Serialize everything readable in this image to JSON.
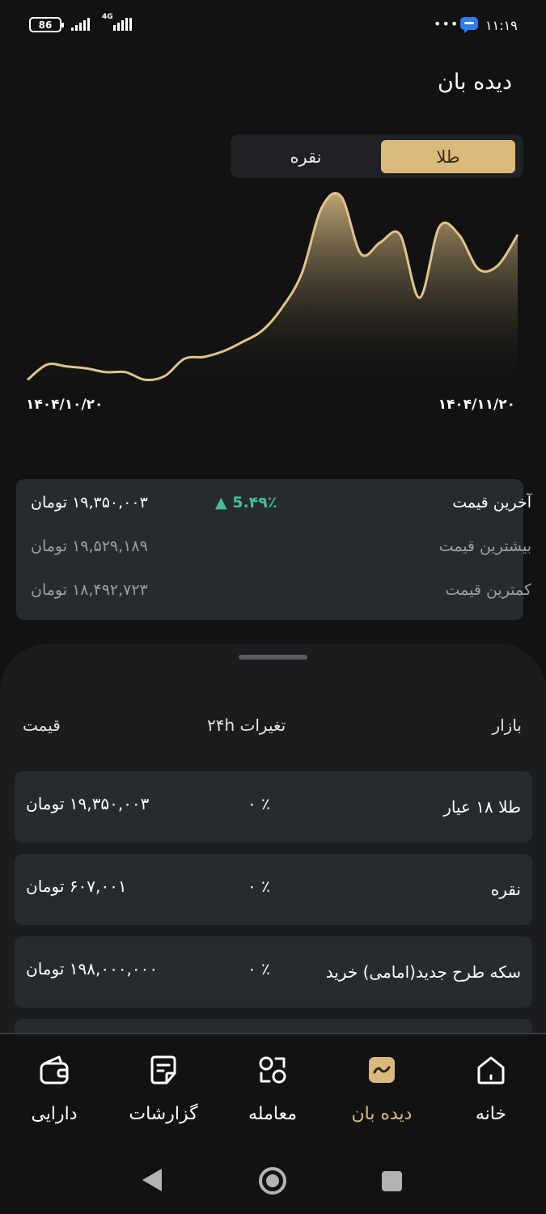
{
  "status_bar": {
    "battery": "86",
    "network": "4G",
    "dots": "•••",
    "time": "۱۱:۱۹"
  },
  "header": {
    "title": "دیده بان"
  },
  "toggle": {
    "gold_label": "طلا",
    "silver_label": "نقره",
    "selected": "طلا"
  },
  "chart": {
    "start_date": "۱۴۰۴/۱۰/۲۰",
    "end_date": "۱۴۰۴/۱۱/۲۰",
    "line_color": "#e0c48a"
  },
  "chart_data": {
    "type": "area",
    "title": "",
    "xlabel": "",
    "ylabel": "",
    "x_range": [
      "۱۴۰۴/۱۰/۲۰",
      "۱۴۰۴/۱۱/۲۰"
    ],
    "values": [
      0.02,
      0.1,
      0.09,
      0.08,
      0.06,
      0.06,
      0.02,
      0.04,
      0.13,
      0.14,
      0.17,
      0.22,
      0.28,
      0.4,
      0.58,
      0.92,
      0.98,
      0.68,
      0.74,
      0.78,
      0.45,
      0.82,
      0.78,
      0.6,
      0.62,
      0.78
    ],
    "grid": false,
    "legend": "none"
  },
  "price_card": {
    "last_price_label": "آخرین قیمت",
    "last_price_value": "۱۹,۳۵۰,۰۰۳ تومان",
    "change": "▲ 5.۴۹٪",
    "max_price_label": "بیشترین قیمت",
    "max_price_value": "۱۹,۵۲۹,۱۸۹ تومان",
    "min_price_label": "کمترین قیمت",
    "min_price_value": "۱۸,۴۹۲,۷۲۳ تومان"
  },
  "market": {
    "headers": {
      "market": "بازار",
      "change": "تغیرات ۲۴h",
      "price": "قیمت"
    },
    "rows": [
      {
        "name": "طلا ۱۸ عیار",
        "change": "٪ ۰",
        "price": "۱۹,۳۵۰,۰۰۳ تومان"
      },
      {
        "name": "نقره",
        "change": "٪ ۰",
        "price": "۶۰۷,۰۰۱ تومان"
      },
      {
        "name": "سکه طرح جدید(امامی) خرید",
        "change": "٪ ۰",
        "price": "۱۹۸,۰۰۰,۰۰۰ تومان"
      }
    ]
  },
  "bottom_nav": {
    "home": "خانه",
    "watch": "دیده بان",
    "trade": "معامله",
    "reports": "گزارشات",
    "assets": "دارایی",
    "active": "دیده بان",
    "accent_color": "#d9ba7c"
  }
}
